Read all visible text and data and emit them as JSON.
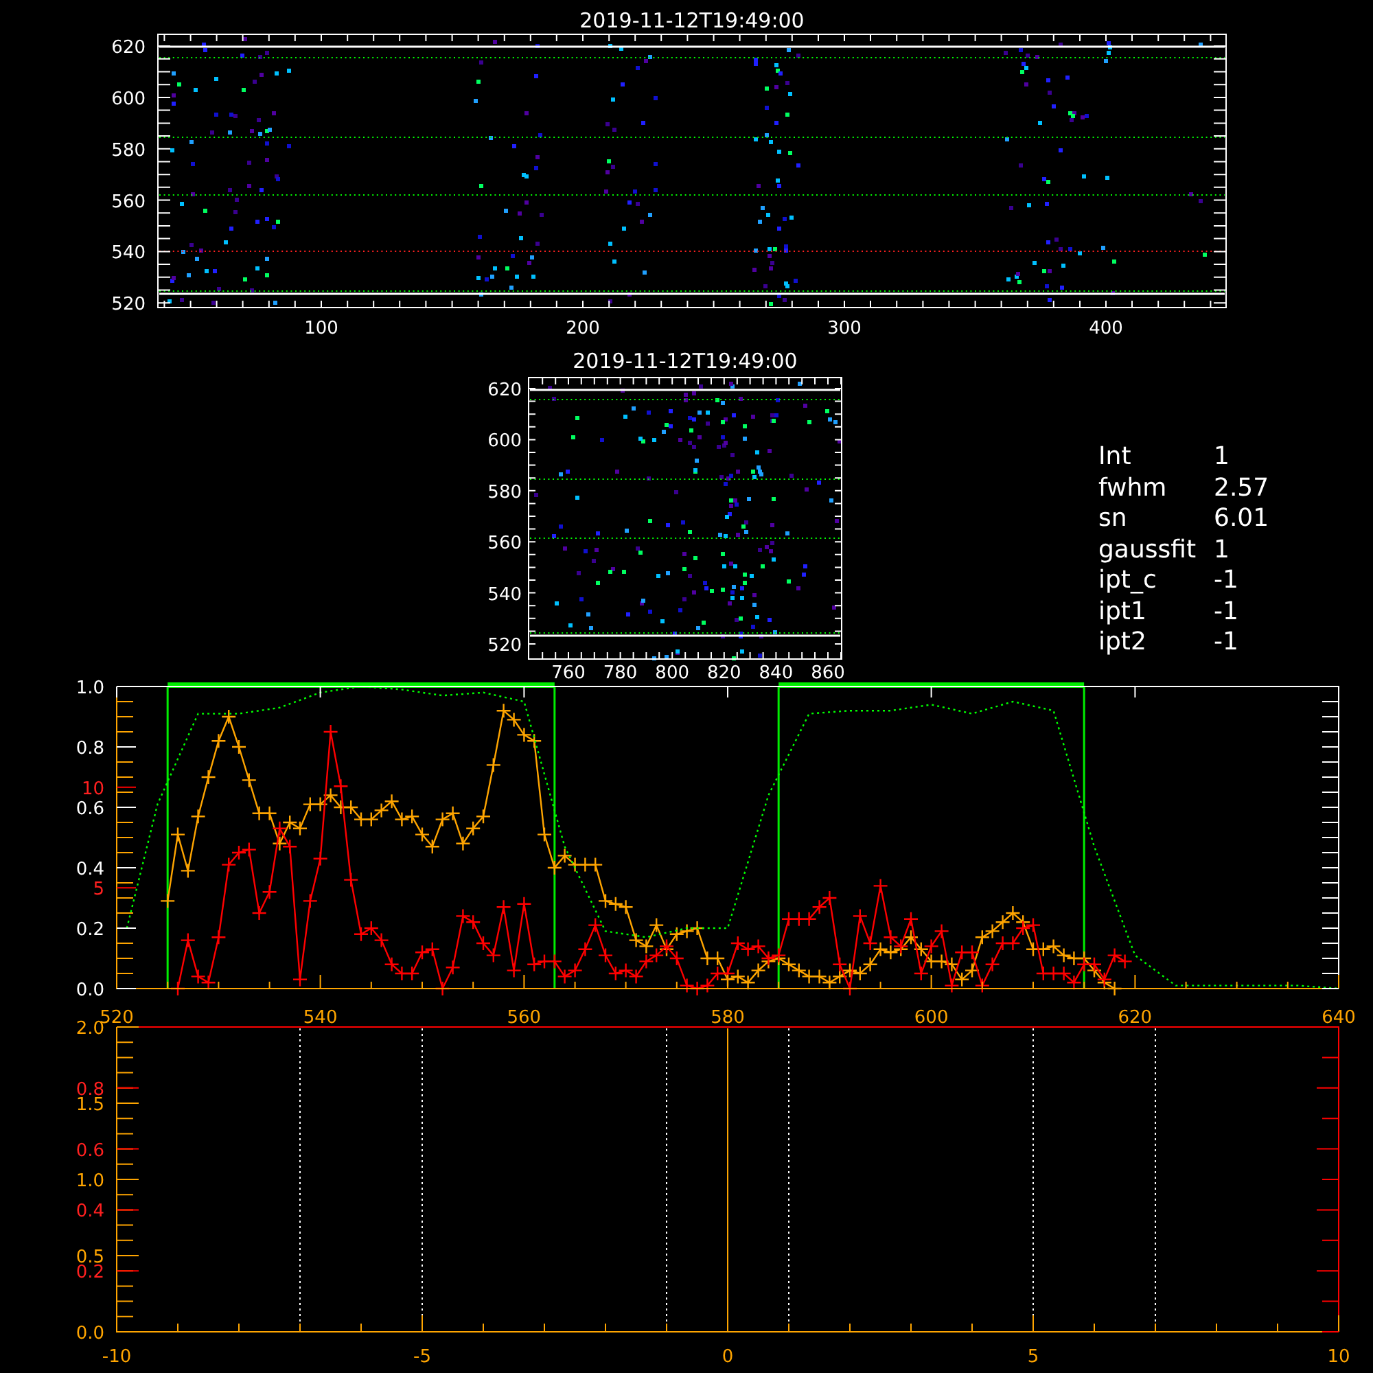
{
  "top_panel": {
    "title": "2019-11-12T19:49:00",
    "x_tick_labels": [
      "100",
      "200",
      "300",
      "400"
    ],
    "y_tick_labels": [
      "620",
      "600",
      "580",
      "560",
      "540",
      "520"
    ]
  },
  "inset_panel": {
    "title": "2019-11-12T19:49:00",
    "x_tick_labels": [
      "760",
      "780",
      "800",
      "820",
      "840",
      "860"
    ],
    "y_tick_labels": [
      "620",
      "600",
      "580",
      "560",
      "540",
      "520"
    ]
  },
  "fit_parameters": [
    {
      "name": "Int",
      "value": "1"
    },
    {
      "name": "fwhm",
      "value": "2.57"
    },
    {
      "name": "sn",
      "value": "6.01"
    },
    {
      "name": "gaussfit",
      "value": "1"
    },
    {
      "name": "ipt_c",
      "value": "-1"
    },
    {
      "name": "ipt1",
      "value": "-1"
    },
    {
      "name": "ipt2",
      "value": "-1"
    }
  ],
  "spectrum_plot": {
    "chart_data": {
      "type": "line",
      "xlim": [
        520,
        640
      ],
      "ylim": [
        0,
        1
      ],
      "xticks": [
        520,
        540,
        560,
        580,
        600,
        620,
        640
      ],
      "yticks": [
        {
          "value": 0,
          "label": "0.0"
        },
        {
          "value": 0.2,
          "label": "0.2"
        },
        {
          "value": 0.4,
          "label": "0.4"
        },
        {
          "value": 0.6,
          "label": "0.6"
        },
        {
          "value": 0.8,
          "label": "0.8"
        },
        {
          "value": 1,
          "label": "1.0"
        }
      ],
      "y2lim": [
        0,
        15
      ],
      "y2ticks": [
        {
          "value": 5,
          "label": "5"
        },
        {
          "value": 10,
          "label": "10"
        }
      ],
      "series": [
        {
          "marker": "+",
          "color": "#ffa500",
          "x": [
            525,
            526,
            527,
            528,
            529,
            530,
            531,
            532,
            533,
            534,
            535,
            536,
            537,
            538,
            539,
            540,
            541,
            542,
            543,
            544,
            545,
            546,
            547,
            548,
            549,
            550,
            551,
            552,
            553,
            554,
            555,
            556,
            557,
            558,
            559,
            560,
            561,
            562,
            563,
            564,
            565,
            566,
            567,
            568,
            569,
            570,
            571,
            572,
            573,
            574,
            575,
            576,
            577,
            578,
            579,
            580,
            581,
            582,
            583,
            584,
            585,
            586,
            587,
            588,
            589,
            590,
            591,
            592,
            593,
            594,
            595,
            596,
            597,
            598,
            599,
            600,
            601,
            602,
            603,
            604,
            605,
            606,
            607,
            608,
            609,
            610,
            611,
            612,
            613,
            614,
            615,
            616,
            617,
            618
          ],
          "values": [
            0.29,
            0.51,
            0.39,
            0.57,
            0.7,
            0.82,
            0.9,
            0.8,
            0.69,
            0.58,
            0.58,
            0.48,
            0.55,
            0.53,
            0.61,
            0.61,
            0.64,
            0.6,
            0.6,
            0.56,
            0.56,
            0.59,
            0.62,
            0.56,
            0.57,
            0.51,
            0.47,
            0.56,
            0.58,
            0.48,
            0.53,
            0.57,
            0.74,
            0.92,
            0.89,
            0.84,
            0.82,
            0.51,
            0.4,
            0.44,
            0.41,
            0.41,
            0.41,
            0.29,
            0.28,
            0.27,
            0.16,
            0.14,
            0.21,
            0.13,
            0.18,
            0.19,
            0.2,
            0.1,
            0.1,
            0.03,
            0.04,
            0.02,
            0.06,
            0.09,
            0.1,
            0.08,
            0.06,
            0.04,
            0.04,
            0.02,
            0.04,
            0.06,
            0.05,
            0.08,
            0.13,
            0.12,
            0.13,
            0.17,
            0.13,
            0.09,
            0.09,
            0.08,
            0.03,
            0.06,
            0.17,
            0.19,
            0.22,
            0.25,
            0.22,
            0.13,
            0.13,
            0.14,
            0.11,
            0.1,
            0.1,
            0.06,
            0.02,
            0.0
          ]
        },
        {
          "marker": "+",
          "color": "#ff0000",
          "x": [
            526,
            527,
            528,
            529,
            530,
            531,
            532,
            533,
            534,
            535,
            536,
            537,
            538,
            539,
            540,
            541,
            542,
            543,
            544,
            545,
            546,
            547,
            548,
            549,
            550,
            551,
            552,
            553,
            554,
            555,
            556,
            557,
            558,
            559,
            560,
            561,
            562,
            563,
            564,
            565,
            566,
            567,
            568,
            569,
            570,
            571,
            572,
            573,
            574,
            575,
            576,
            577,
            578,
            579,
            580,
            581,
            582,
            583,
            584,
            585,
            586,
            587,
            588,
            589,
            590,
            591,
            592,
            593,
            594,
            595,
            596,
            597,
            598,
            599,
            600,
            601,
            602,
            603,
            604,
            605,
            606,
            607,
            608,
            609,
            610,
            611,
            612,
            613,
            614,
            615,
            616,
            617,
            618,
            619
          ],
          "values": [
            0.0,
            0.16,
            0.04,
            0.02,
            0.17,
            0.41,
            0.45,
            0.46,
            0.25,
            0.32,
            0.53,
            0.47,
            0.03,
            0.29,
            0.43,
            0.85,
            0.67,
            0.36,
            0.18,
            0.2,
            0.16,
            0.08,
            0.05,
            0.05,
            0.12,
            0.13,
            0.0,
            0.07,
            0.24,
            0.22,
            0.15,
            0.11,
            0.27,
            0.06,
            0.28,
            0.08,
            0.09,
            0.09,
            0.04,
            0.06,
            0.13,
            0.21,
            0.11,
            0.05,
            0.06,
            0.04,
            0.09,
            0.11,
            0.14,
            0.1,
            0.01,
            0.0,
            0.01,
            0.05,
            0.05,
            0.15,
            0.13,
            0.14,
            0.1,
            0.11,
            0.23,
            0.23,
            0.23,
            0.27,
            0.3,
            0.08,
            0.0,
            0.24,
            0.15,
            0.34,
            0.17,
            0.14,
            0.23,
            0.05,
            0.14,
            0.19,
            0.01,
            0.12,
            0.12,
            0.01,
            0.08,
            0.15,
            0.15,
            0.2,
            0.21,
            0.05,
            0.05,
            0.05,
            0.02,
            0.08,
            0.08,
            0.03,
            0.11,
            0.09
          ]
        },
        {
          "line_style": "dotted",
          "color": "#00ff00",
          "x": [
            521,
            524,
            528,
            532,
            536,
            540,
            544,
            548,
            552,
            556,
            560,
            564,
            568,
            572,
            576,
            580,
            584,
            588,
            592,
            596,
            600,
            604,
            608,
            612,
            616,
            620,
            624,
            628,
            632,
            636,
            640
          ],
          "values": [
            0.2,
            0.61,
            0.91,
            0.91,
            0.93,
            0.98,
            1.0,
            0.99,
            0.97,
            0.98,
            0.95,
            0.47,
            0.19,
            0.17,
            0.2,
            0.2,
            0.64,
            0.91,
            0.92,
            0.92,
            0.94,
            0.91,
            0.95,
            0.92,
            0.47,
            0.11,
            0.01,
            0.01,
            0.01,
            0.01,
            0.0
          ]
        }
      ],
      "ref_lines": [
        {
          "axis": "x",
          "value": 525,
          "line_style": "solid",
          "color": "#00ee00"
        },
        {
          "axis": "x",
          "value": 563,
          "line_style": "solid",
          "color": "#00ee00"
        },
        {
          "axis": "x",
          "value": 585,
          "line_style": "solid",
          "color": "#00ee00"
        },
        {
          "axis": "x",
          "value": 615,
          "line_style": "solid",
          "color": "#00ee00"
        }
      ]
    }
  },
  "offset_plot": {
    "chart_data": {
      "type": "line",
      "xlim": [
        -10,
        10
      ],
      "ylim": [
        0,
        2
      ],
      "xticks": [
        -10,
        -5,
        0,
        5,
        10
      ],
      "yticks": [
        {
          "value": 0,
          "label": "0.0"
        },
        {
          "value": 0.5,
          "label": "0.5"
        },
        {
          "value": 1,
          "label": "1.0"
        },
        {
          "value": 1.5,
          "label": "1.5"
        },
        {
          "value": 2,
          "label": "2.0"
        }
      ],
      "y2lim": [
        0,
        1
      ],
      "y2ticks": [
        {
          "value": 0.2,
          "label": "0.2"
        },
        {
          "value": 0.4,
          "label": "0.4"
        },
        {
          "value": 0.6,
          "label": "0.6"
        },
        {
          "value": 0.8,
          "label": "0.8"
        }
      ],
      "ref_lines": [
        {
          "axis": "x",
          "value": -7,
          "line_style": "dotted",
          "color": "#ffffff"
        },
        {
          "axis": "x",
          "value": -5,
          "line_style": "dotted",
          "color": "#ffffff"
        },
        {
          "axis": "x",
          "value": -1,
          "line_style": "dotted",
          "color": "#ffffff"
        },
        {
          "axis": "x",
          "value": 0,
          "line_style": "solid",
          "color": "#ffa500"
        },
        {
          "axis": "x",
          "value": 1,
          "line_style": "dotted",
          "color": "#ffffff"
        },
        {
          "axis": "x",
          "value": 5,
          "line_style": "dotted",
          "color": "#ffffff"
        },
        {
          "axis": "x",
          "value": 7,
          "line_style": "dotted",
          "color": "#ffffff"
        }
      ]
    }
  }
}
